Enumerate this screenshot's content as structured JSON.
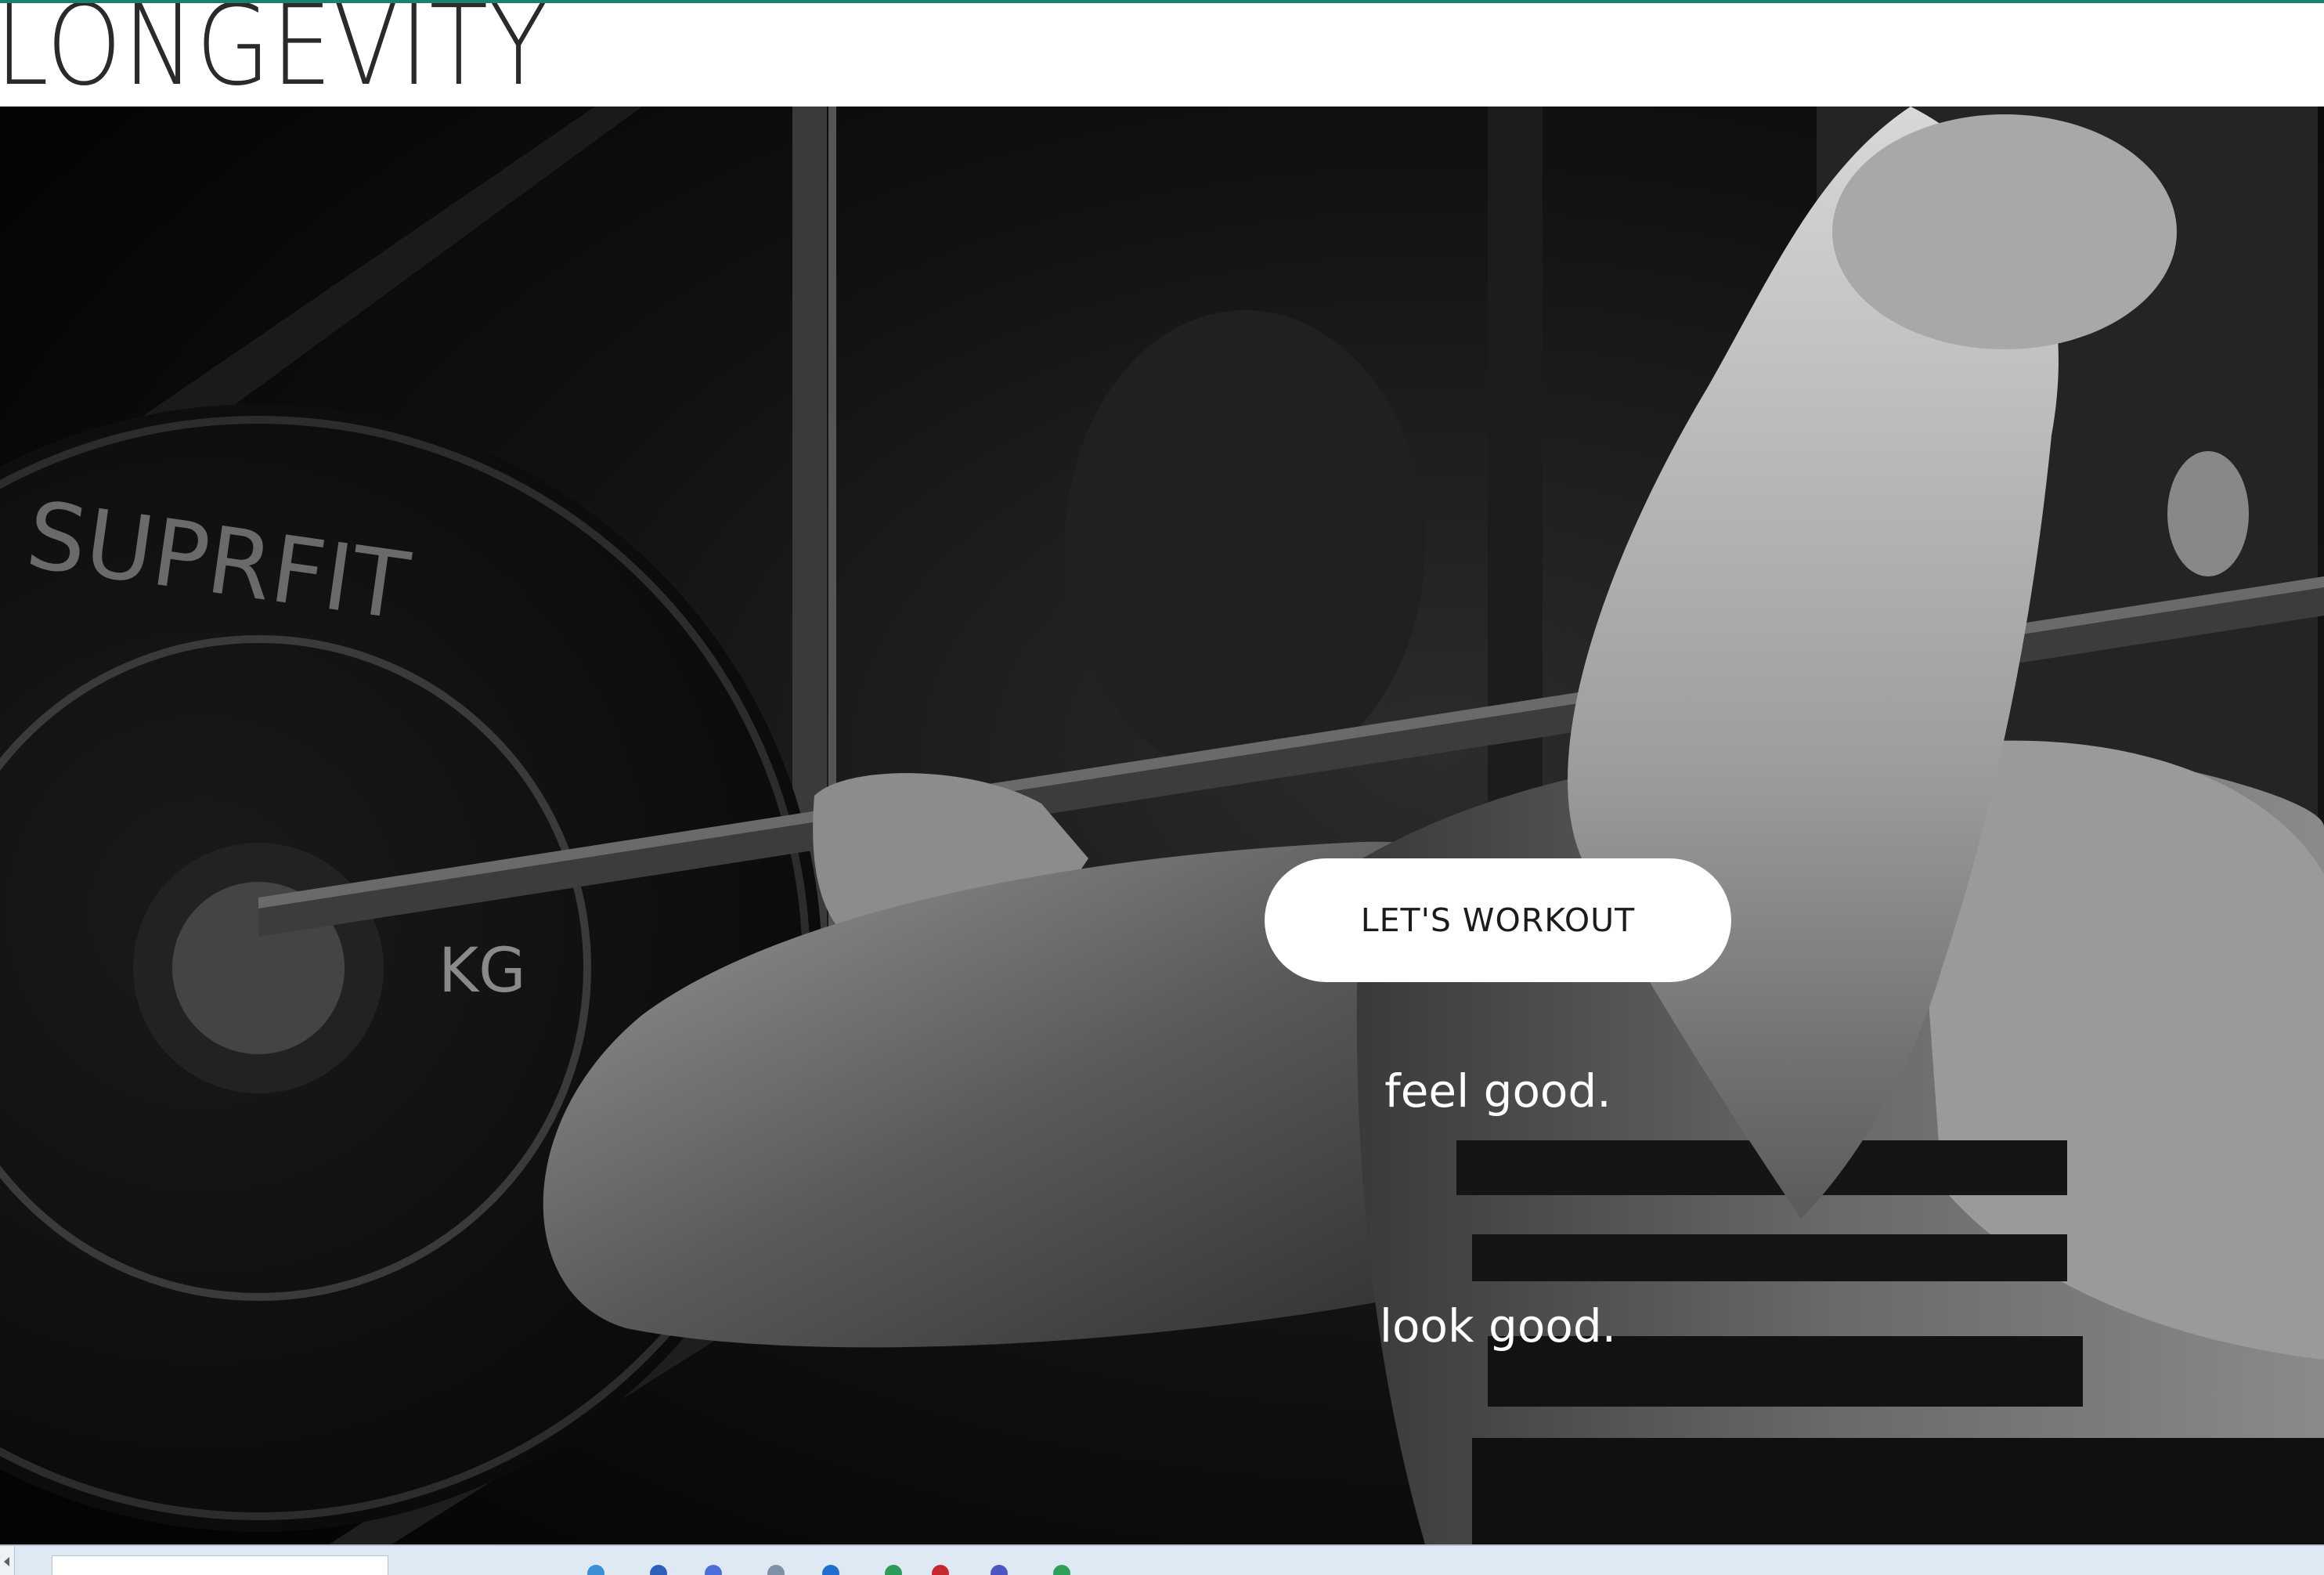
{
  "brand": {
    "name": "LONGEVITY"
  },
  "hero": {
    "cta_label": "LET'S WORKOUT",
    "taglines": [
      "feel good.",
      "look good."
    ]
  },
  "colors": {
    "accent_top": "#1e7e6f",
    "header_bg": "#ffffff",
    "button_bg": "#ffffff",
    "button_text": "#1b1b1b",
    "tagline_text": "#ffffff"
  },
  "icons": {
    "barbell_plate_text": [
      "SUPRFIT",
      "KG"
    ]
  }
}
